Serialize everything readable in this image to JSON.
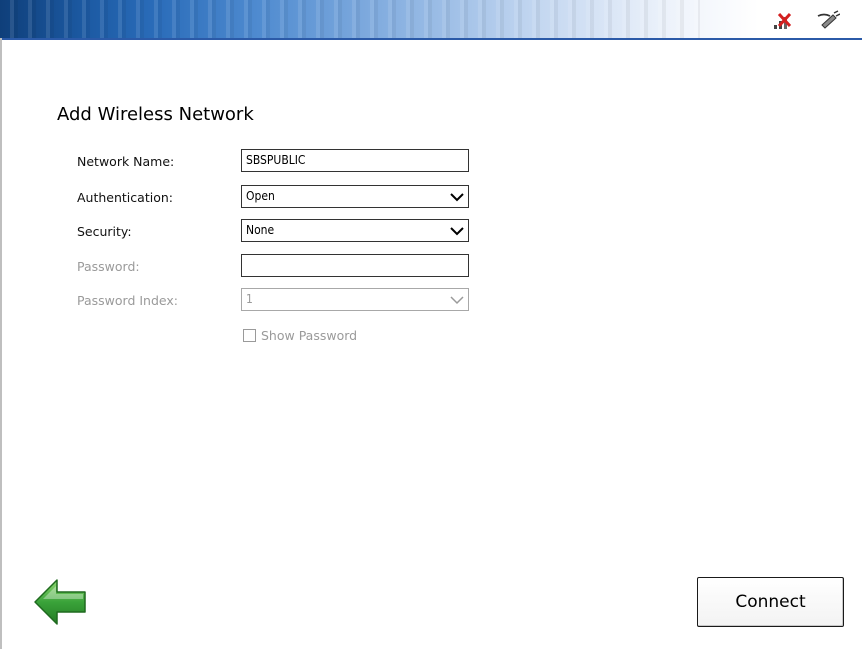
{
  "title": "Add Wireless Network",
  "form": {
    "network_name": {
      "label": "Network Name:",
      "value": "SBSPUBLIC"
    },
    "authentication": {
      "label": "Authentication:",
      "value": "Open"
    },
    "security": {
      "label": "Security:",
      "value": "None"
    },
    "password": {
      "label": "Password:",
      "value": ""
    },
    "password_index": {
      "label": "Password Index:",
      "value": "1"
    },
    "show_password": {
      "label": "Show Password",
      "checked": false
    }
  },
  "buttons": {
    "connect_label": "Connect"
  },
  "tray": {
    "icons": [
      "wireless-disconnected-icon",
      "power-plug-icon"
    ]
  },
  "colors": {
    "title_bar_dark": "#0f3f7a",
    "disabled_text": "#9a9a9a",
    "back_arrow": "#3aa33a"
  }
}
